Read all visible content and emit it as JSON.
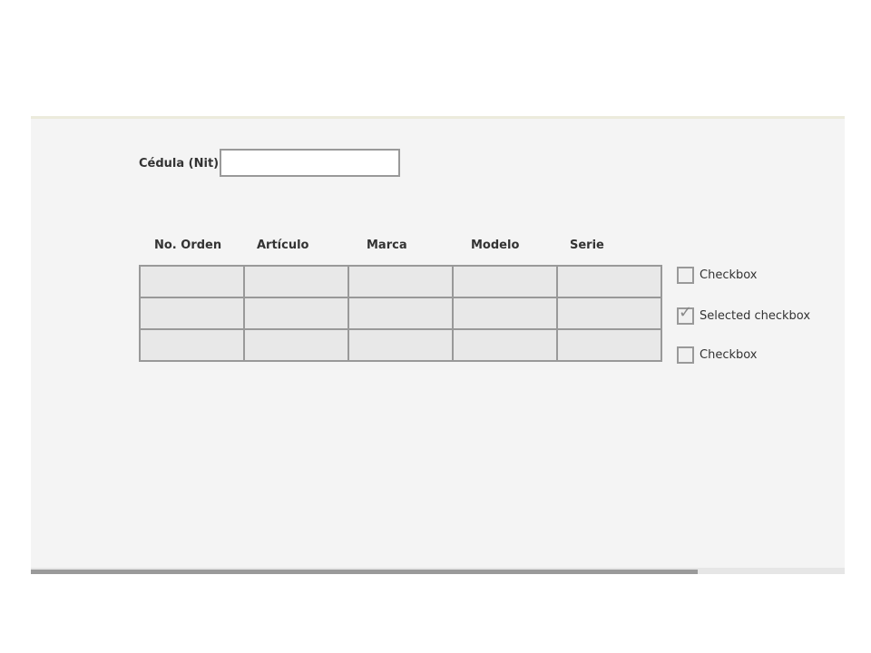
{
  "form": {
    "cedula_label": "Cédula (Nit):",
    "cedula_value": "",
    "cedula_placeholder": ""
  },
  "table": {
    "columns": [
      "No. Orden",
      "Artículo",
      "Marca",
      "Modelo",
      "Serie"
    ],
    "rows": [
      [
        "",
        "",
        "",
        "",
        ""
      ],
      [
        "",
        "",
        "",
        "",
        ""
      ],
      [
        "",
        "",
        "",
        "",
        ""
      ]
    ]
  },
  "checkboxes": [
    {
      "label": "Checkbox",
      "checked": false
    },
    {
      "label": "Selected checkbox",
      "checked": true
    },
    {
      "label": "Checkbox",
      "checked": false
    }
  ],
  "colors": {
    "panel_bg": "#f4f4f4",
    "cell_bg": "#e8e8e8",
    "border": "#999999"
  }
}
